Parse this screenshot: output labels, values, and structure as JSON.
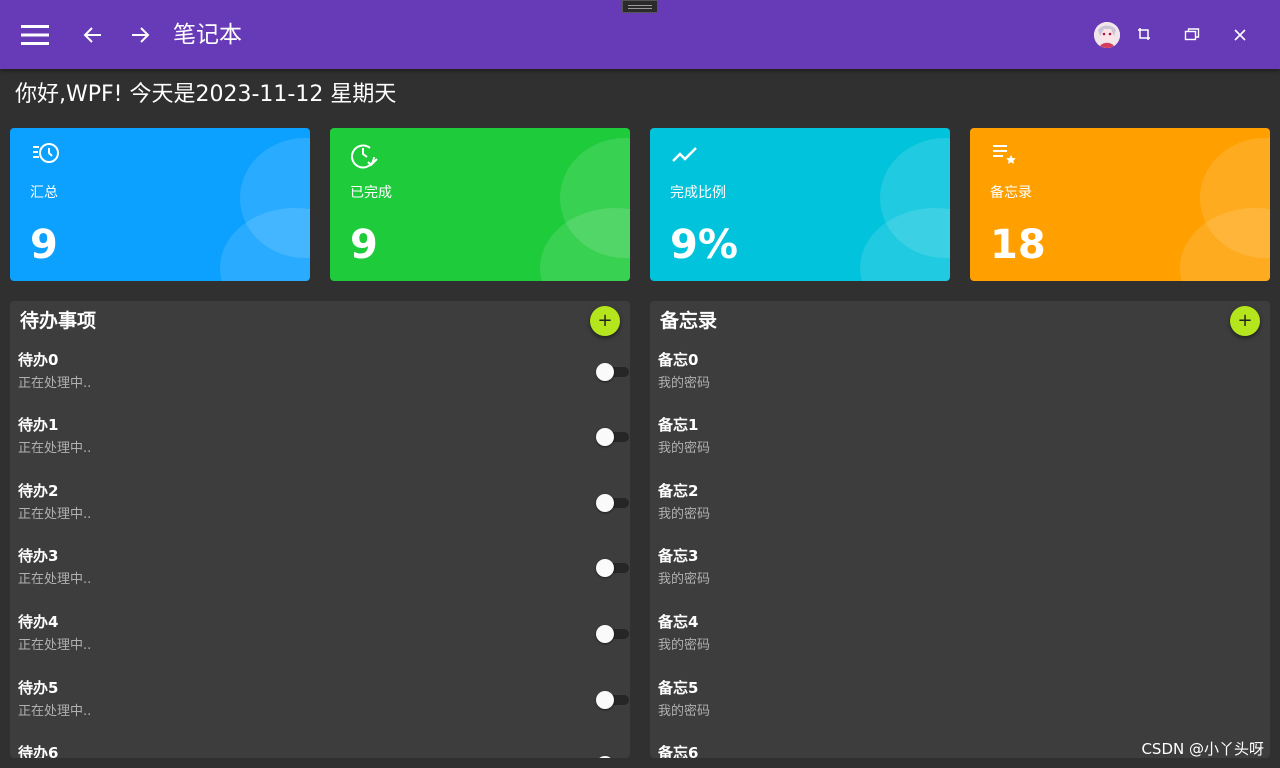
{
  "window": {
    "title": "笔记本",
    "colors": {
      "titlebar": "#673ab7",
      "background": "#303030",
      "panel": "#3d3d3d",
      "accent_button": "#b5e61d"
    },
    "icons": [
      "menu-icon",
      "back-arrow-icon",
      "forward-arrow-icon",
      "user-avatar",
      "resize-icon",
      "restore-icon",
      "close-icon"
    ]
  },
  "greeting": "你好,WPF! 今天是2023-11-12 星期天",
  "stats": [
    {
      "label": "汇总",
      "value": "9",
      "icon": "clock-history-icon",
      "color": "#0ca1ff"
    },
    {
      "label": "已完成",
      "value": "9",
      "icon": "clock-check-icon",
      "color": "#1ecb3b"
    },
    {
      "label": "完成比例",
      "value": "9%",
      "icon": "trend-line-icon",
      "color": "#02c3dc"
    },
    {
      "label": "备忘录",
      "value": "18",
      "icon": "list-star-icon",
      "color": "#ffa000"
    }
  ],
  "todo": {
    "title": "待办事项",
    "add_label": "+",
    "items": [
      {
        "title": "待办0",
        "desc": "正在处理中.."
      },
      {
        "title": "待办1",
        "desc": "正在处理中.."
      },
      {
        "title": "待办2",
        "desc": "正在处理中.."
      },
      {
        "title": "待办3",
        "desc": "正在处理中.."
      },
      {
        "title": "待办4",
        "desc": "正在处理中.."
      },
      {
        "title": "待办5",
        "desc": "正在处理中.."
      },
      {
        "title": "待办6",
        "desc": ""
      }
    ]
  },
  "memo": {
    "title": "备忘录",
    "add_label": "+",
    "items": [
      {
        "title": "备忘0",
        "desc": "我的密码"
      },
      {
        "title": "备忘1",
        "desc": "我的密码"
      },
      {
        "title": "备忘2",
        "desc": "我的密码"
      },
      {
        "title": "备忘3",
        "desc": "我的密码"
      },
      {
        "title": "备忘4",
        "desc": "我的密码"
      },
      {
        "title": "备忘5",
        "desc": "我的密码"
      },
      {
        "title": "备忘6",
        "desc": ""
      }
    ]
  },
  "watermark": "CSDN @小丫头呀"
}
